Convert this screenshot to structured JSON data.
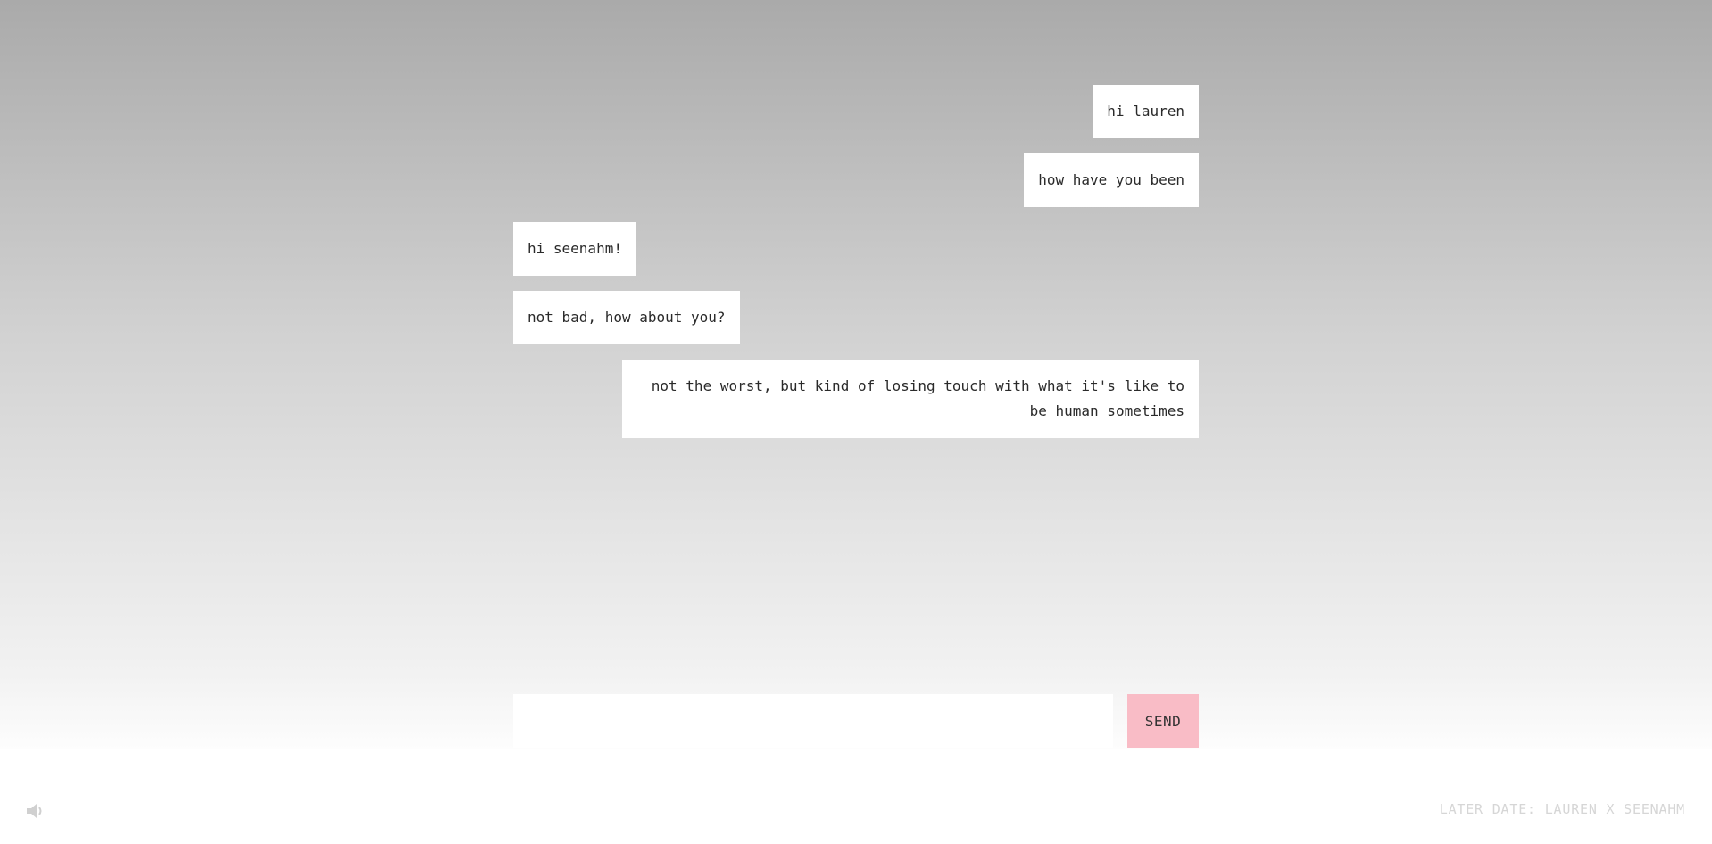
{
  "messages": [
    {
      "sender": "me",
      "text": "hi lauren"
    },
    {
      "sender": "me",
      "text": "how have you been"
    },
    {
      "sender": "them",
      "text": "hi seenahm!"
    },
    {
      "sender": "them",
      "text": "not bad, how about you?"
    },
    {
      "sender": "me",
      "text": "not the worst, but kind of losing touch with what it's like to be human sometimes"
    }
  ],
  "composer": {
    "input_value": "",
    "input_placeholder": "",
    "send_label": "SEND",
    "send_color": "#f9bcc6"
  },
  "footer": {
    "sound_icon": "speaker-icon",
    "title": "LATER DATE: LAUREN X SEENAHM"
  }
}
